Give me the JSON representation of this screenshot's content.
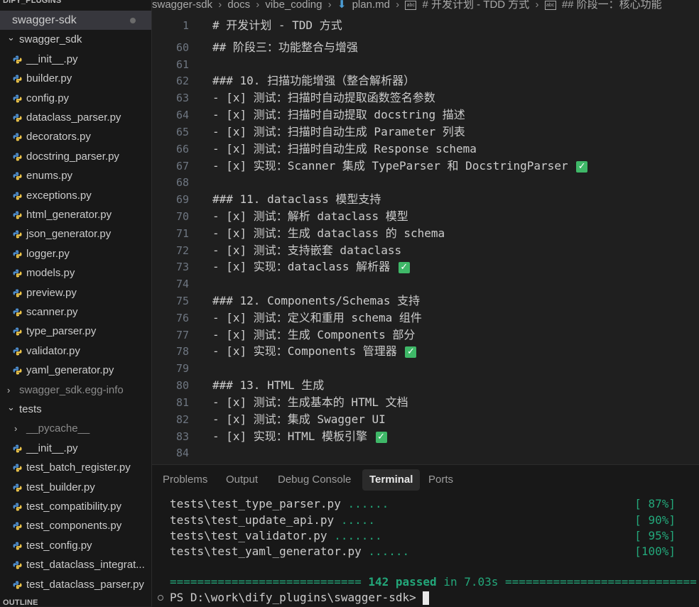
{
  "sidebar": {
    "section_top": "DIFY_PLUGINS",
    "section_bottom": "OUTLINE",
    "root": "swagger-sdk",
    "package": "swagger_sdk",
    "package_files": [
      "__init__.py",
      "builder.py",
      "config.py",
      "dataclass_parser.py",
      "decorators.py",
      "docstring_parser.py",
      "enums.py",
      "exceptions.py",
      "html_generator.py",
      "json_generator.py",
      "logger.py",
      "models.py",
      "preview.py",
      "scanner.py",
      "type_parser.py",
      "validator.py",
      "yaml_generator.py"
    ],
    "egg_info": "swagger_sdk.egg-info",
    "tests_folder": "tests",
    "pycache": "__pycache__",
    "test_files": [
      "__init__.py",
      "test_batch_register.py",
      "test_builder.py",
      "test_compatibility.py",
      "test_components.py",
      "test_config.py",
      "test_dataclass_integrat...",
      "test_dataclass_parser.py"
    ]
  },
  "breadcrumb": {
    "items": [
      "swagger-sdk",
      "docs",
      "vibe_coding",
      "plan.md",
      "# 开发计划 - TDD 方式",
      "## 阶段一：核心功能"
    ]
  },
  "editor": {
    "lines": [
      {
        "n": "1",
        "text": "# 开发计划 - TDD 方式",
        "check": false
      },
      {
        "n": "60",
        "text": "## 阶段三：功能整合与增强",
        "check": false
      },
      {
        "n": "61",
        "text": "",
        "check": false
      },
      {
        "n": "62",
        "text": "### 10. 扫描功能增强（整合解析器）",
        "check": false
      },
      {
        "n": "63",
        "text": "- [x] 测试：扫描时自动提取函数签名参数",
        "check": false
      },
      {
        "n": "64",
        "text": "- [x] 测试：扫描时自动提取 docstring 描述",
        "check": false
      },
      {
        "n": "65",
        "text": "- [x] 测试：扫描时自动生成 Parameter 列表",
        "check": false
      },
      {
        "n": "66",
        "text": "- [x] 测试：扫描时自动生成 Response schema",
        "check": false
      },
      {
        "n": "67",
        "text": "- [x] 实现：Scanner 集成 TypeParser 和 DocstringParser ",
        "check": true
      },
      {
        "n": "68",
        "text": "",
        "check": false
      },
      {
        "n": "69",
        "text": "### 11. dataclass 模型支持",
        "check": false
      },
      {
        "n": "70",
        "text": "- [x] 测试：解析 dataclass 模型",
        "check": false
      },
      {
        "n": "71",
        "text": "- [x] 测试：生成 dataclass 的 schema",
        "check": false
      },
      {
        "n": "72",
        "text": "- [x] 测试：支持嵌套 dataclass",
        "check": false
      },
      {
        "n": "73",
        "text": "- [x] 实现：dataclass 解析器 ",
        "check": true
      },
      {
        "n": "74",
        "text": "",
        "check": false
      },
      {
        "n": "75",
        "text": "### 12. Components/Schemas 支持",
        "check": false
      },
      {
        "n": "76",
        "text": "- [x] 测试：定义和重用 schema 组件",
        "check": false
      },
      {
        "n": "77",
        "text": "- [x] 测试：生成 Components 部分",
        "check": false
      },
      {
        "n": "78",
        "text": "- [x] 实现：Components 管理器 ",
        "check": true
      },
      {
        "n": "79",
        "text": "",
        "check": false
      },
      {
        "n": "80",
        "text": "### 13. HTML 生成",
        "check": false
      },
      {
        "n": "81",
        "text": "- [x] 测试：生成基本的 HTML 文档",
        "check": false
      },
      {
        "n": "82",
        "text": "- [x] 测试：集成 Swagger UI",
        "check": false
      },
      {
        "n": "83",
        "text": "- [x] 实现：HTML 模板引擎 ",
        "check": true
      },
      {
        "n": "84",
        "text": "",
        "check": false
      }
    ]
  },
  "panel": {
    "tabs": [
      "Problems",
      "Output",
      "Debug Console",
      "Terminal",
      "Ports"
    ],
    "active_tab": "Terminal",
    "terminal_lines": [
      {
        "file": "tests\\test_type_parser.py",
        "dots": " ......",
        "pct": "[ 87%]"
      },
      {
        "file": "tests\\test_update_api.py",
        "dots": " .....",
        "pct": "[ 90%]"
      },
      {
        "file": "tests\\test_validator.py",
        "dots": " .......",
        "pct": "[ 95%]"
      },
      {
        "file": "tests\\test_yaml_generator.py",
        "dots": " ......",
        "pct": "[100%]"
      }
    ],
    "summary": {
      "left": "============================ ",
      "passed": "142 passed",
      "mid": " in 7.03s ",
      "right": "============================"
    },
    "prompt": "PS D:\\work\\dify_plugins\\swagger-sdk> "
  }
}
